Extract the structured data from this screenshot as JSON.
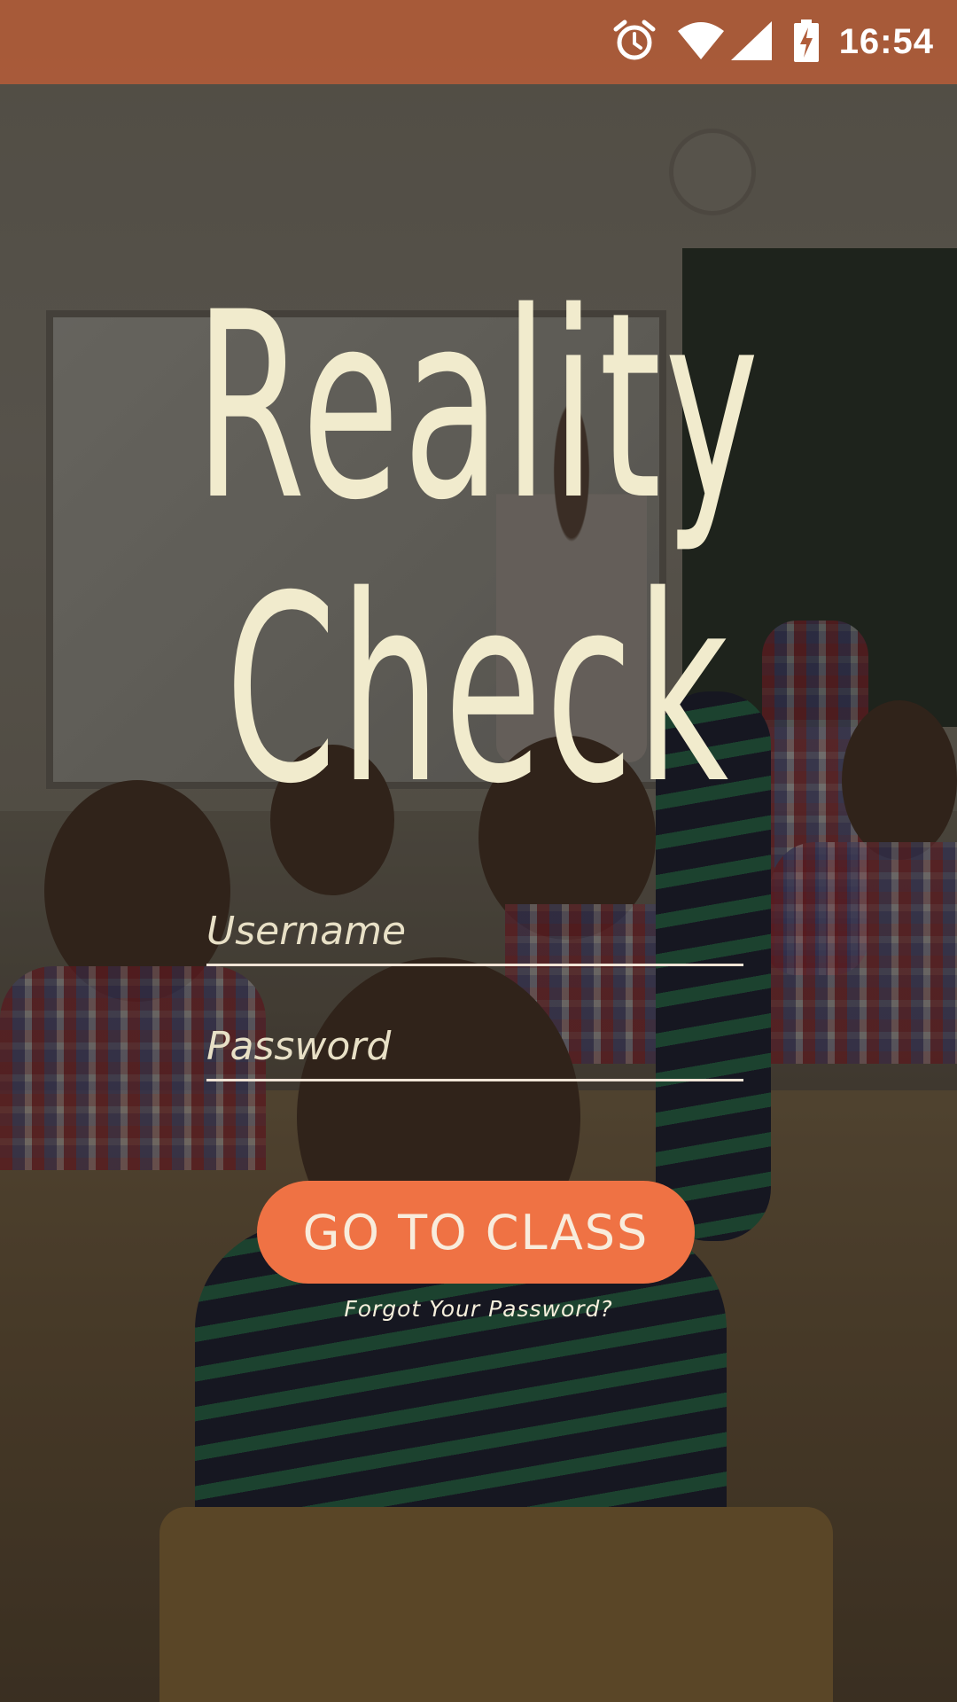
{
  "status_bar": {
    "time": "16:54",
    "icons": [
      "alarm-icon",
      "wifi-icon",
      "cell-signal-icon",
      "battery-charging-icon"
    ]
  },
  "login": {
    "title_line1": "Reality",
    "title_line2": "Check",
    "username_placeholder": "Username",
    "password_placeholder": "Password",
    "submit_label": "GO TO CLASS",
    "forgot_label": "Forgot Your Password?"
  },
  "colors": {
    "status_bar": "#B05C3A",
    "title": "#F1EBCD",
    "button": "#EF7244",
    "underline": "#F0E4D6"
  }
}
